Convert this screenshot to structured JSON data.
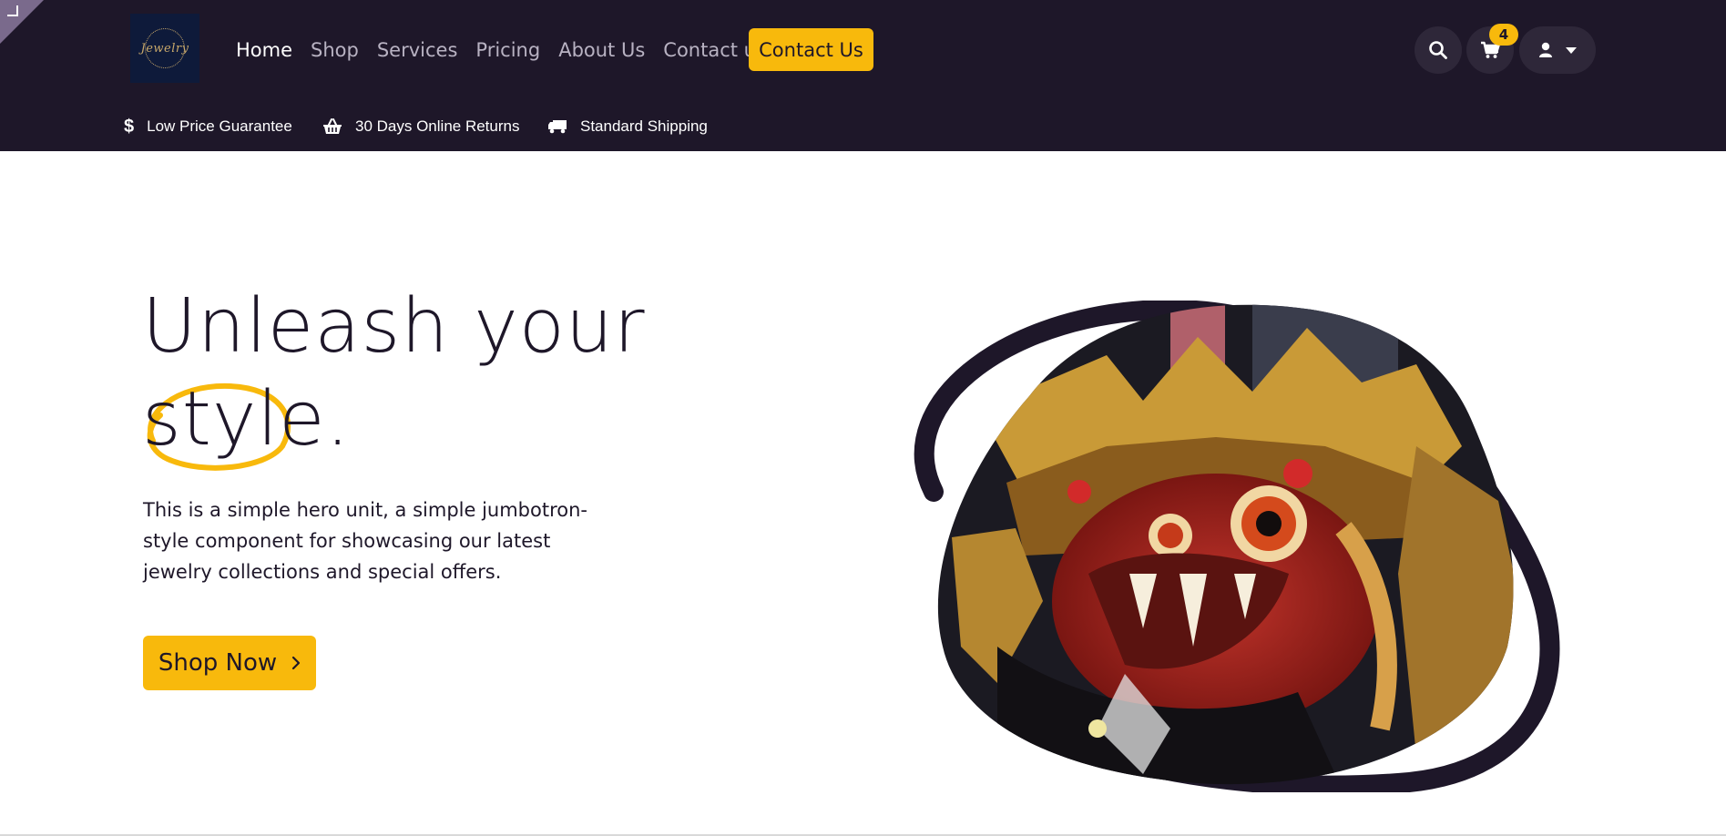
{
  "brand": {
    "logo_text": "Jewelry",
    "colors": {
      "header_bg": "#1e1729",
      "accent": "#f8b90c",
      "icon_bg": "#2e2739"
    }
  },
  "nav": {
    "items": [
      {
        "label": "Home",
        "active": true
      },
      {
        "label": "Shop"
      },
      {
        "label": "Services"
      },
      {
        "label": "Pricing"
      },
      {
        "label": "About Us"
      },
      {
        "label": "Contact us"
      }
    ],
    "contact_button": "Contact Us"
  },
  "header_icons": {
    "search": "search-icon",
    "cart": "cart-icon",
    "cart_count": "4",
    "user": "user-icon",
    "dropdown": "caret-down-icon"
  },
  "usp": [
    {
      "icon": "dollar-icon",
      "label": "Low Price Guarantee"
    },
    {
      "icon": "basket-icon",
      "label": "30 Days Online Returns"
    },
    {
      "icon": "truck-icon",
      "label": "Standard Shipping"
    }
  ],
  "hero": {
    "title_line1": "Unleash your",
    "title_highlight": "style",
    "title_end": ".",
    "description": "This is a simple hero unit, a simple jumbotron-style component for showcasing our latest jewelry collections and special offers.",
    "cta_label": "Shop Now",
    "cta_icon": "chevron-right-icon",
    "image_subject": "Barong mask"
  }
}
